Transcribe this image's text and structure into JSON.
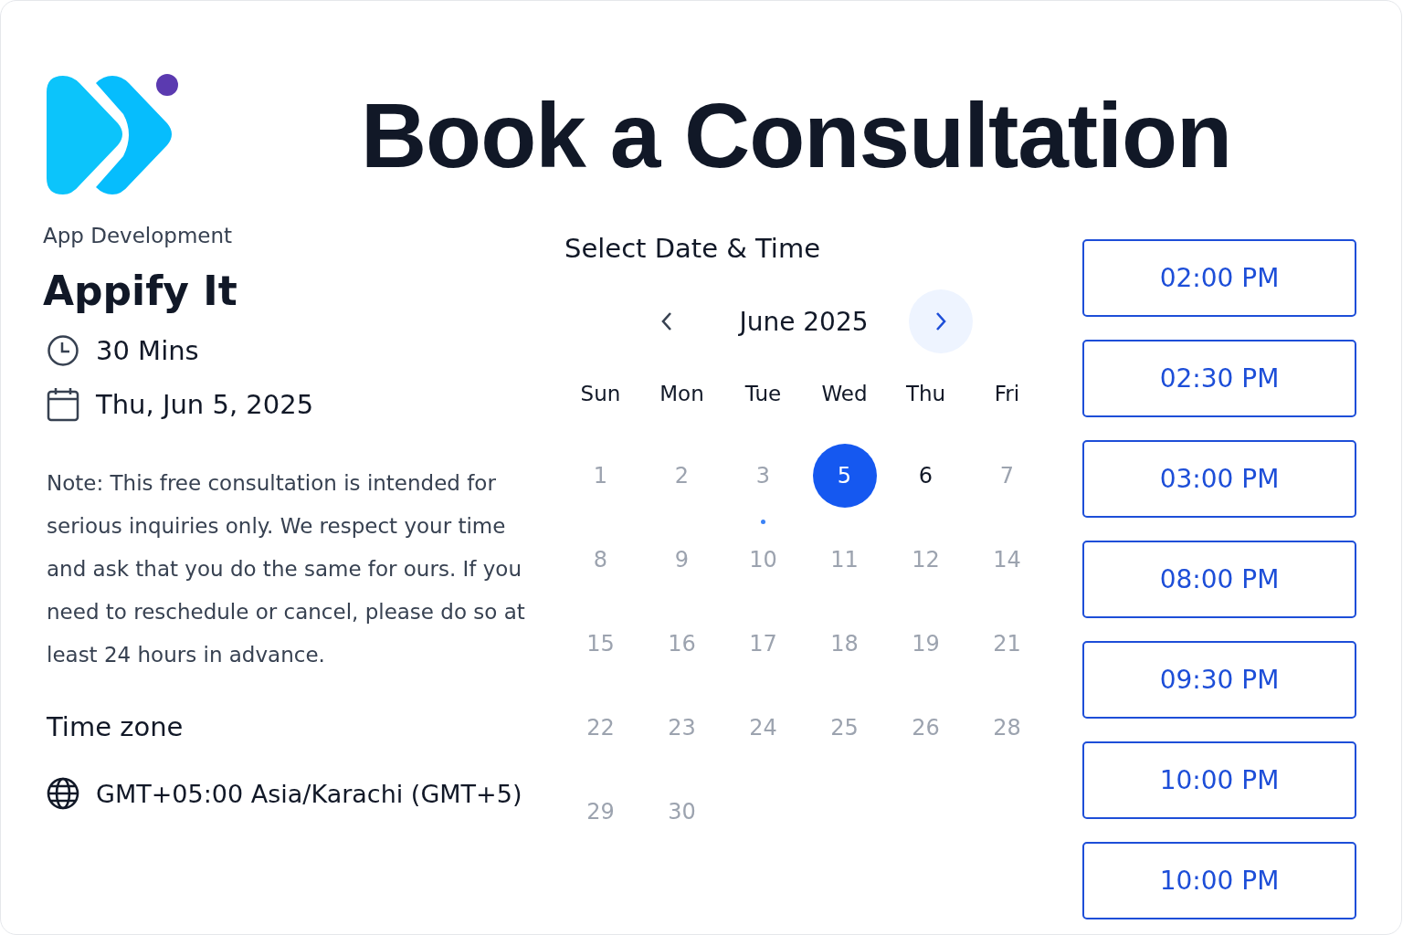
{
  "brand": {
    "category": "App Development",
    "name": "Appify It"
  },
  "title": "Book a Consultation",
  "details": [
    {
      "kind": "duration",
      "text": "30 Mins"
    },
    {
      "kind": "date",
      "text": "Thu, Jun 5, 2025"
    }
  ],
  "note": "Note: This free consultation is intended for serious inquiries only. We respect your time and ask that you do the same for ours. If you need to reschedule or cancel, please do so at least 24 hours in advance.",
  "timezone": {
    "heading": "Time zone",
    "value": "GMT+05:00 Asia/Karachi (GMT+5)"
  },
  "calendar": {
    "heading": "Select Date & Time",
    "month": "June 2025",
    "weekdays": [
      "Sun",
      "Mon",
      "Tue",
      "Wed",
      "Thu",
      "Fri"
    ],
    "days": [
      {
        "label": "1",
        "available": false,
        "selected": false,
        "today": false
      },
      {
        "label": "2",
        "available": false,
        "selected": false,
        "today": false
      },
      {
        "label": "3",
        "available": false,
        "selected": false,
        "today": true
      },
      {
        "label": "5",
        "available": true,
        "selected": true,
        "today": false
      },
      {
        "label": "6",
        "available": true,
        "selected": false,
        "today": false
      },
      {
        "label": "7",
        "available": false,
        "selected": false,
        "today": false
      },
      {
        "label": "8",
        "available": false,
        "selected": false,
        "today": false
      },
      {
        "label": "9",
        "available": false,
        "selected": false,
        "today": false
      },
      {
        "label": "10",
        "available": false,
        "selected": false,
        "today": false
      },
      {
        "label": "11",
        "available": false,
        "selected": false,
        "today": false
      },
      {
        "label": "12",
        "available": false,
        "selected": false,
        "today": false
      },
      {
        "label": "14",
        "available": false,
        "selected": false,
        "today": false
      },
      {
        "label": "15",
        "available": false,
        "selected": false,
        "today": false
      },
      {
        "label": "16",
        "available": false,
        "selected": false,
        "today": false
      },
      {
        "label": "17",
        "available": false,
        "selected": false,
        "today": false
      },
      {
        "label": "18",
        "available": false,
        "selected": false,
        "today": false
      },
      {
        "label": "19",
        "available": false,
        "selected": false,
        "today": false
      },
      {
        "label": "21",
        "available": false,
        "selected": false,
        "today": false
      },
      {
        "label": "22",
        "available": false,
        "selected": false,
        "today": false
      },
      {
        "label": "23",
        "available": false,
        "selected": false,
        "today": false
      },
      {
        "label": "24",
        "available": false,
        "selected": false,
        "today": false
      },
      {
        "label": "25",
        "available": false,
        "selected": false,
        "today": false
      },
      {
        "label": "26",
        "available": false,
        "selected": false,
        "today": false
      },
      {
        "label": "28",
        "available": false,
        "selected": false,
        "today": false
      },
      {
        "label": "29",
        "available": false,
        "selected": false,
        "today": false
      },
      {
        "label": "30",
        "available": false,
        "selected": false,
        "today": false
      }
    ]
  },
  "time_slots": [
    "02:00 PM",
    "02:30 PM",
    "03:00 PM",
    "08:00 PM",
    "09:30 PM",
    "10:00 PM",
    "10:00 PM"
  ]
}
